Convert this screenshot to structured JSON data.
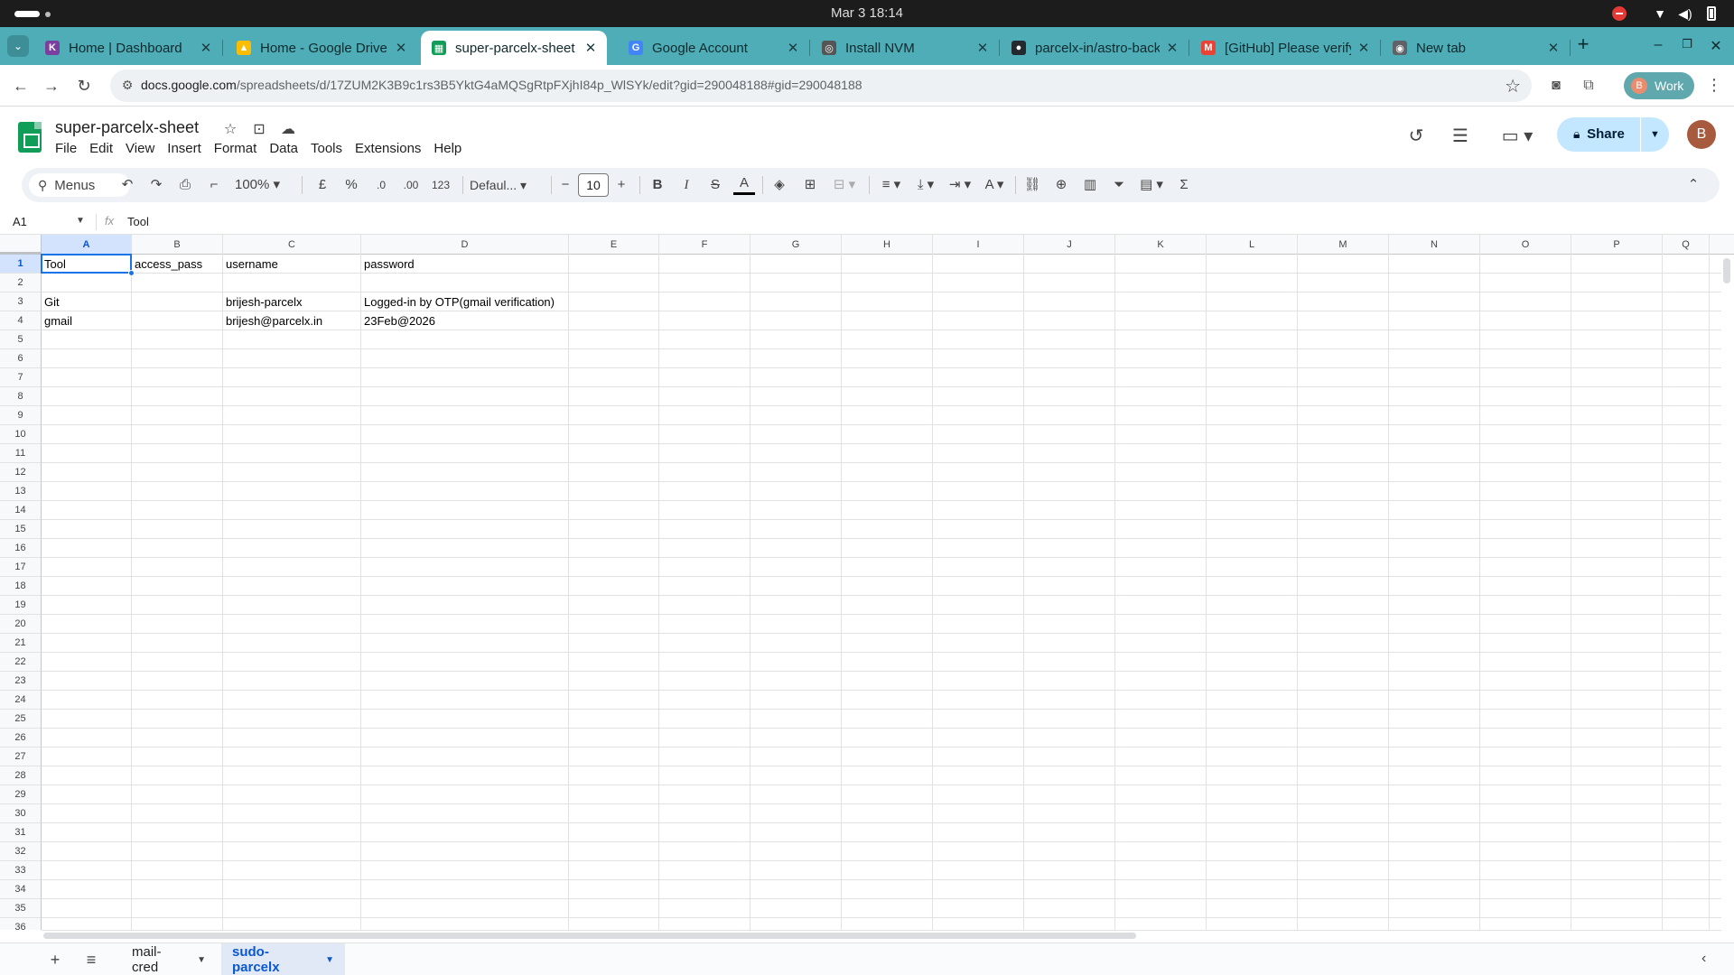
{
  "os": {
    "clock": "Mar 3  18:14"
  },
  "browser": {
    "tabs": [
      {
        "title": "Home | Dashboard",
        "fav_color": "#7b3fa0",
        "fav_glyph": "K"
      },
      {
        "title": "Home - Google Drive",
        "fav_color": "#fbbc04",
        "fav_glyph": "▲"
      },
      {
        "title": "super-parcelx-sheet -",
        "fav_color": "#0f9d58",
        "fav_glyph": "▦"
      },
      {
        "title": "Google Account",
        "fav_color": "#4285f4",
        "fav_glyph": "G"
      },
      {
        "title": "Install NVM",
        "fav_color": "#555555",
        "fav_glyph": "◎"
      },
      {
        "title": "parcelx-in/astro-back",
        "fav_color": "#24292f",
        "fav_glyph": "●"
      },
      {
        "title": "[GitHub] Please verify",
        "fav_color": "#ea4335",
        "fav_glyph": "M"
      },
      {
        "title": "New tab",
        "fav_color": "#5f6368",
        "fav_glyph": "◉"
      }
    ],
    "active_tab_index": 2,
    "url_host": "docs.google.com",
    "url_path": "/spreadsheets/d/17ZUM2K3B9c1rs3B5YktG4aMQSgRtpFXjhI84p_WlSYk/edit?gid=290048188#gid=290048188",
    "profile": {
      "initial": "B",
      "label": "Work"
    },
    "accent": "#4eadb6"
  },
  "sheets": {
    "doc_title": "super-parcelx-sheet",
    "menu": [
      "File",
      "Edit",
      "View",
      "Insert",
      "Format",
      "Data",
      "Tools",
      "Extensions",
      "Help"
    ],
    "share_label": "Share",
    "user_initial": "B",
    "toolbar": {
      "search_label": "Menus",
      "zoom": "100%",
      "currency": "£",
      "percent": "%",
      "dec_decrease": ".0",
      "dec_increase": ".00",
      "number_format": "123",
      "font": "Defaul...",
      "font_size": "10"
    },
    "name_box": "A1",
    "formula_value": "Tool",
    "columns": [
      "A",
      "B",
      "C",
      "D",
      "E",
      "F",
      "G",
      "H",
      "I",
      "J",
      "K",
      "L",
      "M",
      "N",
      "O",
      "P",
      "Q"
    ],
    "row_count": 36,
    "selected_cell": "A1",
    "cells": {
      "r1": [
        "Tool",
        "access_pass",
        "username",
        "password"
      ],
      "r3": [
        "Git",
        "",
        "brijesh-parcelx",
        "Logged-in by OTP(gmail verification)"
      ],
      "r4": [
        "gmail",
        "",
        "brijesh@parcelx.in",
        "23Feb@2026"
      ]
    },
    "sheet_tabs": [
      "mail-cred",
      "sudo-parcelx"
    ],
    "active_sheet_index": 1
  }
}
